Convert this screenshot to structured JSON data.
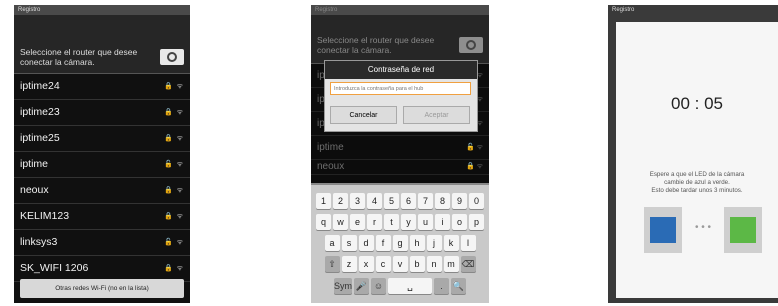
{
  "screen1": {
    "status_title": "Registro",
    "prompt": "Seleccione el router que desee conectar la cámara.",
    "networks": [
      {
        "name": "iptime24",
        "icons": "🔒 ᯤ"
      },
      {
        "name": "iptime23",
        "icons": "🔒 ᯤ"
      },
      {
        "name": "iptime25",
        "icons": "🔒 ᯤ"
      },
      {
        "name": "iptime",
        "icons": "🔓 ᯤ"
      },
      {
        "name": "neoux",
        "icons": "🔒 ᯤ"
      },
      {
        "name": "KELIM123",
        "icons": "🔒 ᯤ"
      },
      {
        "name": "linksys3",
        "icons": "🔓 ᯤ"
      },
      {
        "name": "SK_WIFI 1206",
        "icons": "🔒 ᯤ"
      }
    ],
    "other_networks_button": "Otras redes Wi-Fi (no en la lista)"
  },
  "screen2": {
    "status_title": "Registro",
    "prompt": "Seleccione el router que desee conectar la cámara.",
    "background_networks": [
      "ip",
      "ip",
      "ip",
      "iptime",
      "neoux"
    ],
    "dialog": {
      "title": "Contraseña de red",
      "placeholder": "Introduzca la contraseña para el hub",
      "cancel": "Cancelar",
      "accept": "Aceptar"
    },
    "keyboard": {
      "row1": [
        "1",
        "2",
        "3",
        "4",
        "5",
        "6",
        "7",
        "8",
        "9",
        "0"
      ],
      "row2": [
        "q",
        "w",
        "e",
        "r",
        "t",
        "y",
        "u",
        "i",
        "o",
        "p"
      ],
      "row3": [
        "a",
        "s",
        "d",
        "f",
        "g",
        "h",
        "j",
        "k",
        "l"
      ],
      "row4": [
        "⇧",
        "z",
        "x",
        "c",
        "v",
        "b",
        "n",
        "m",
        "⌫"
      ],
      "row5": [
        "Sym",
        "🎤",
        "☺",
        "␣",
        ".",
        "🔍"
      ]
    }
  },
  "screen3": {
    "status_title": "Registro",
    "timer": "00 : 05",
    "message_line1": "Espere a que el LED de la cámara",
    "message_line2": "cambie de azul a verde.",
    "message_line3": "Esto debe tardar unos 3 minutos.",
    "led_from_color": "#2a6bb5",
    "led_to_color": "#5cb846",
    "dots": "• • •"
  }
}
